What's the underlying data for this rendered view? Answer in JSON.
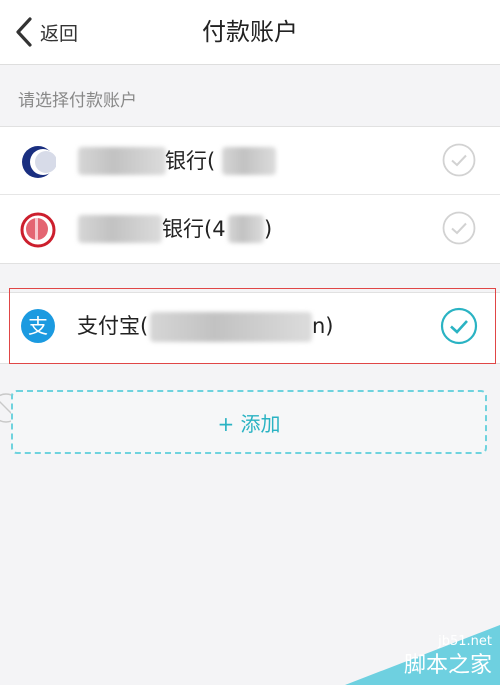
{
  "header": {
    "back_label": "返回",
    "title": "付款账户"
  },
  "section": {
    "hint": "请选择付款账户"
  },
  "accounts": [
    {
      "name_suffix": "银行(",
      "paren_close": "",
      "selected": false,
      "logo": "bank-blue-logo"
    },
    {
      "name_suffix": "银行(4",
      "paren_close": ")",
      "selected": false,
      "logo": "bank-red-logo"
    }
  ],
  "alipay": {
    "label": "支付宝(",
    "tail": "n)",
    "selected": true,
    "logo": "alipay-icon"
  },
  "actions": {
    "add_label": "+ 添加"
  },
  "watermark": {
    "url": "jb51.net",
    "name": "脚本之家"
  },
  "colors": {
    "accent": "#2ab3c3",
    "highlight": "#e04646",
    "alipay_blue": "#1b9ae0"
  }
}
